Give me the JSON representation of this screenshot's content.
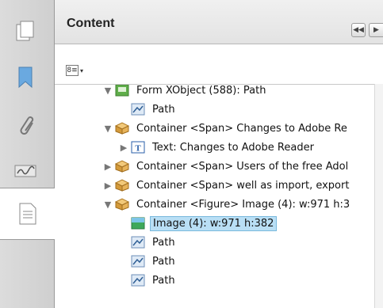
{
  "panel": {
    "title": "Content",
    "nav_prev": "◀◀",
    "nav_next": "▶",
    "options_glyph": "8≡",
    "options_caret": "▾"
  },
  "rail": [
    {
      "name": "pages-icon"
    },
    {
      "name": "bookmark-icon"
    },
    {
      "name": "attachments-icon"
    },
    {
      "name": "signatures-icon"
    },
    {
      "name": "content-icon",
      "active": true
    }
  ],
  "tree": [
    {
      "label": "Form XObject (588): Path",
      "icon": "form-xobject-icon",
      "toggle": "▼",
      "level": 1
    },
    {
      "label": "Path",
      "icon": "path-icon",
      "toggle": "",
      "level": 2
    },
    {
      "label": "Container <Span> Changes to Adobe Re",
      "icon": "container-icon",
      "toggle": "▼",
      "level": 1
    },
    {
      "label": "Text: Changes to Adobe Reader",
      "icon": "text-icon",
      "toggle": "▶",
      "level": 2
    },
    {
      "label": "Container <Span> Users of the free Adol",
      "icon": "container-icon",
      "toggle": "▶",
      "level": 1
    },
    {
      "label": "Container <Span> well as import, export",
      "icon": "container-icon",
      "toggle": "▶",
      "level": 1
    },
    {
      "label": "Container <Figure> Image (4): w:971 h:3",
      "icon": "container-icon",
      "toggle": "▼",
      "level": 1
    },
    {
      "label": "Image (4): w:971 h:382",
      "icon": "image-icon",
      "toggle": "",
      "level": 2,
      "selected": true
    },
    {
      "label": "Path",
      "icon": "path-icon",
      "toggle": "",
      "level": 2
    },
    {
      "label": "Path",
      "icon": "path-icon",
      "toggle": "",
      "level": 2
    },
    {
      "label": "Path",
      "icon": "path-icon",
      "toggle": "",
      "level": 2
    }
  ],
  "colors": {
    "selection": "#b9dff5",
    "container_box": "#d49a3a",
    "text_icon": "#2a5fa8"
  }
}
